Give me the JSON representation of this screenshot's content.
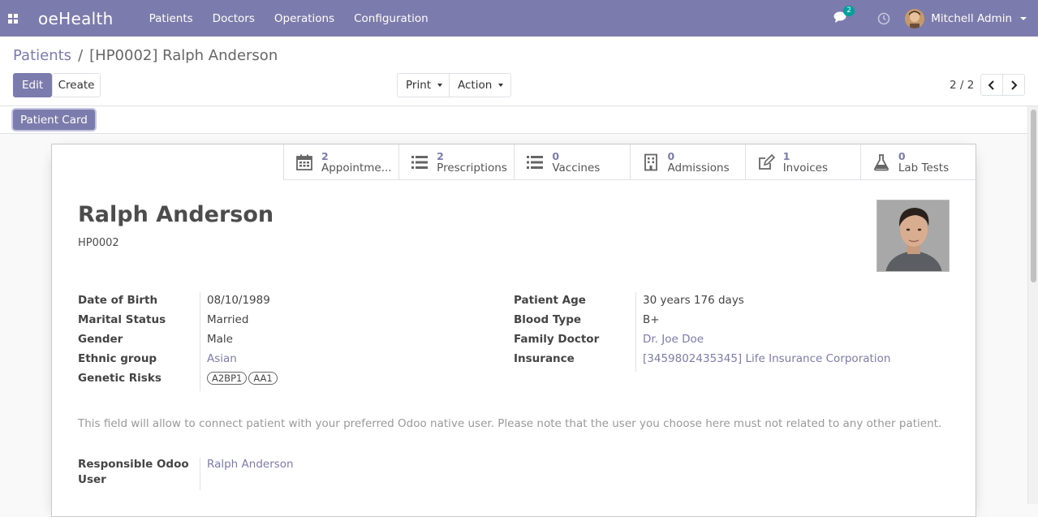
{
  "navbar": {
    "brand": "oeHealth",
    "menu": [
      "Patients",
      "Doctors",
      "Operations",
      "Configuration"
    ],
    "chat_count": "2",
    "user_name": "Mitchell Admin",
    "color": "#7c7bad"
  },
  "breadcrumb": {
    "parent": "Patients",
    "separator": "/",
    "current": "[HP0002] Ralph Anderson"
  },
  "toolbar": {
    "edit": "Edit",
    "create": "Create",
    "print": "Print",
    "action": "Action",
    "pager": "2 / 2"
  },
  "statusbar": {
    "patient_card": "Patient Card"
  },
  "smart_buttons": [
    {
      "value": "2",
      "label": "Appointme...",
      "icon": "calendar-icon"
    },
    {
      "value": "2",
      "label": "Prescriptions",
      "icon": "list-icon"
    },
    {
      "value": "0",
      "label": "Vaccines",
      "icon": "list-icon"
    },
    {
      "value": "0",
      "label": "Admissions",
      "icon": "building-icon"
    },
    {
      "value": "1",
      "label": "Invoices",
      "icon": "pencil-square-icon"
    },
    {
      "value": "0",
      "label": "Lab Tests",
      "icon": "flask-icon"
    }
  ],
  "patient": {
    "name": "Ralph Anderson",
    "code": "HP0002"
  },
  "left_fields": {
    "dob_label": "Date of Birth",
    "dob": "08/10/1989",
    "marital_label": "Marital Status",
    "marital": "Married",
    "gender_label": "Gender",
    "gender": "Male",
    "ethnic_label": "Ethnic group",
    "ethnic": "Asian",
    "genetic_label": "Genetic Risks",
    "genetic_tags": [
      "A2BP1",
      "AA1"
    ]
  },
  "right_fields": {
    "age_label": "Patient Age",
    "age": "30 years 176 days",
    "blood_label": "Blood Type",
    "blood": "B+",
    "doctor_label": "Family Doctor",
    "doctor": "Dr. Joe Doe",
    "insurance_label": "Insurance",
    "insurance": "[3459802435345] Life Insurance Corporation"
  },
  "help_text": "This field will allow to connect patient with your preferred Odoo native user. Please note that the user you choose here must not related to any other patient.",
  "responsible": {
    "label_line1": "Responsible Odoo",
    "label_line2": "User",
    "value": "Ralph Anderson"
  }
}
